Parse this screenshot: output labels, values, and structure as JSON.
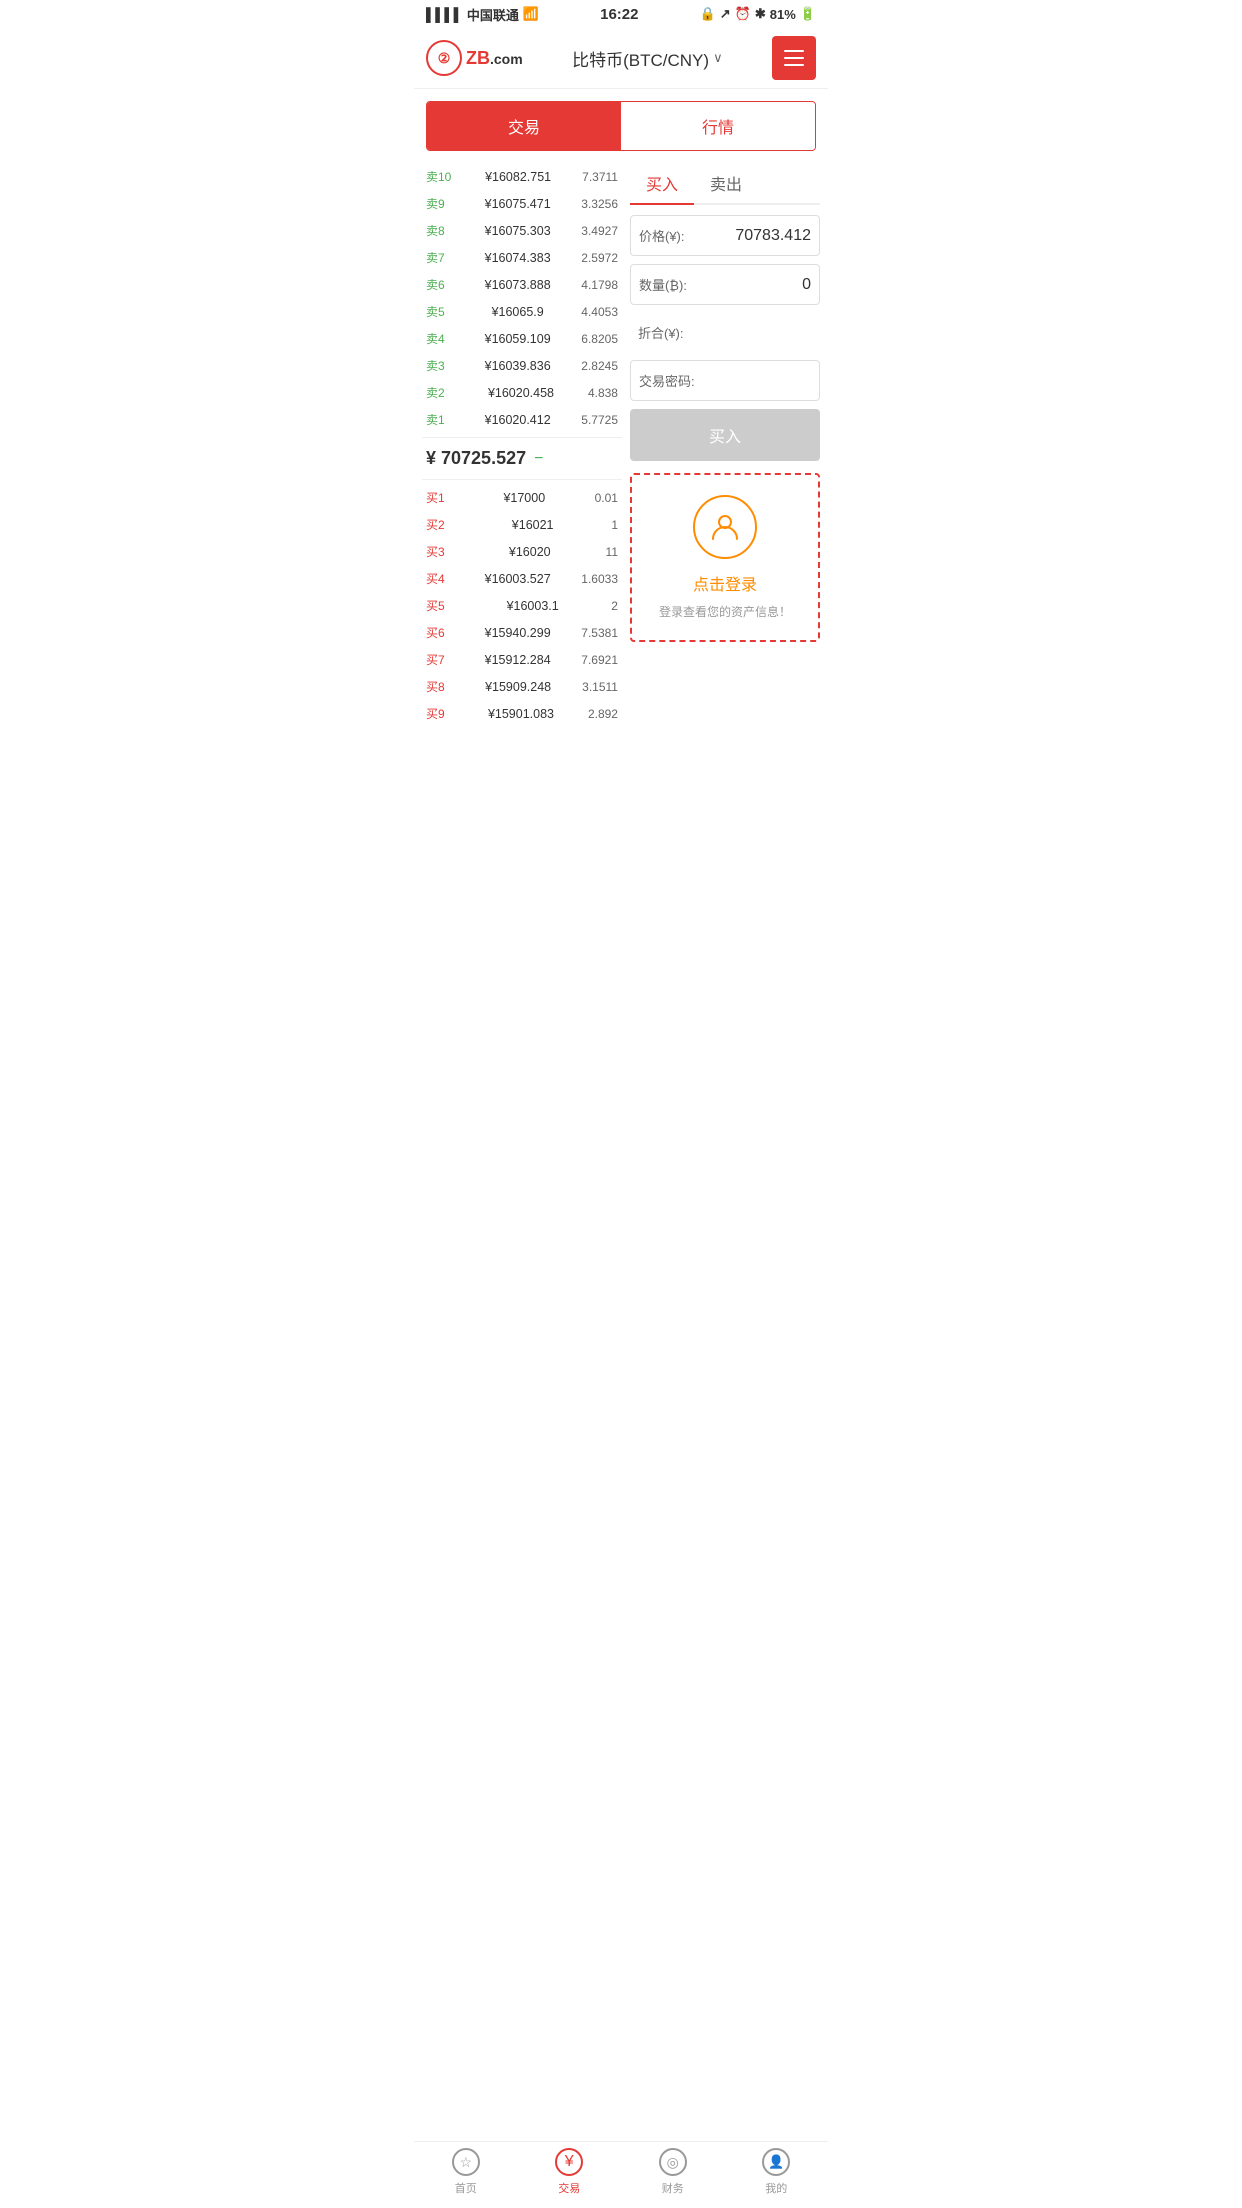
{
  "statusBar": {
    "carrier": "中国联通",
    "time": "16:22",
    "battery": "81%"
  },
  "header": {
    "logoText": "ZB",
    "logoDomain": ".com",
    "title": "比特币(BTC/CNY)",
    "chevron": "∨",
    "menuLabel": "菜单"
  },
  "tabs": {
    "trade": "交易",
    "market": "行情"
  },
  "orderBook": {
    "sellOrders": [
      {
        "label": "卖10",
        "price": "¥16082.751",
        "amount": "7.3711"
      },
      {
        "label": "卖9",
        "price": "¥16075.471",
        "amount": "3.3256"
      },
      {
        "label": "卖8",
        "price": "¥16075.303",
        "amount": "3.4927"
      },
      {
        "label": "卖7",
        "price": "¥16074.383",
        "amount": "2.5972"
      },
      {
        "label": "卖6",
        "price": "¥16073.888",
        "amount": "4.1798"
      },
      {
        "label": "卖5",
        "price": "¥16065.9",
        "amount": "4.4053"
      },
      {
        "label": "卖4",
        "price": "¥16059.109",
        "amount": "6.8205"
      },
      {
        "label": "卖3",
        "price": "¥16039.836",
        "amount": "2.8245"
      },
      {
        "label": "卖2",
        "price": "¥16020.458",
        "amount": "4.838"
      },
      {
        "label": "卖1",
        "price": "¥16020.412",
        "amount": "5.7725"
      }
    ],
    "currentPrice": "¥ 70725.527",
    "currentArrow": "−",
    "buyOrders": [
      {
        "label": "买1",
        "price": "¥17000",
        "amount": "0.01"
      },
      {
        "label": "买2",
        "price": "¥16021",
        "amount": "1"
      },
      {
        "label": "买3",
        "price": "¥16020",
        "amount": "11"
      },
      {
        "label": "买4",
        "price": "¥16003.527",
        "amount": "1.6033"
      },
      {
        "label": "买5",
        "price": "¥16003.1",
        "amount": "2"
      },
      {
        "label": "买6",
        "price": "¥15940.299",
        "amount": "7.5381"
      },
      {
        "label": "买7",
        "price": "¥15912.284",
        "amount": "7.6921"
      },
      {
        "label": "买8",
        "price": "¥15909.248",
        "amount": "3.1511"
      },
      {
        "label": "买9",
        "price": "¥15901.083",
        "amount": "2.892"
      }
    ]
  },
  "tradePanel": {
    "buyTab": "买入",
    "sellTab": "卖出",
    "priceLabel": "价格(¥):",
    "priceValue": "70783.412",
    "amountLabel": "数量(₿):",
    "amountValue": "0",
    "totalLabel": "折合(¥):",
    "totalValue": "",
    "passwordLabel": "交易密码:",
    "buyButton": "买入",
    "loginTitle": "点击登录",
    "loginSub": "登录查看您的资产信息！"
  },
  "bottomNav": [
    {
      "label": "首页",
      "icon": "★",
      "active": false
    },
    {
      "label": "交易",
      "icon": "¥",
      "active": true
    },
    {
      "label": "财务",
      "icon": "◎",
      "active": false
    },
    {
      "label": "我的",
      "icon": "人",
      "active": false
    }
  ]
}
